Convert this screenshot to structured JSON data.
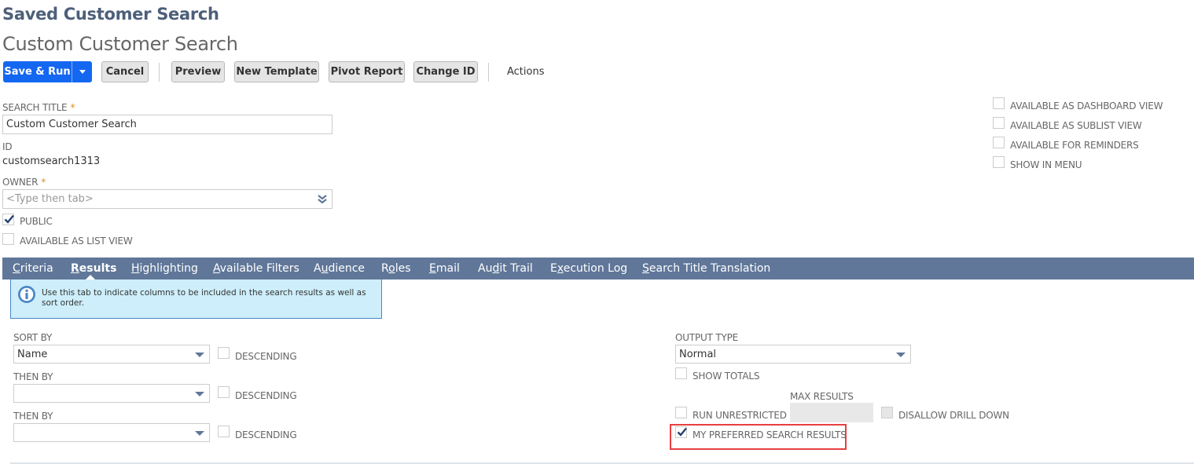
{
  "header": {
    "record_type": "Saved Customer Search",
    "record_name": "Custom Customer Search"
  },
  "toolbar": {
    "save_run_label": "Save & Run",
    "cancel_label": "Cancel",
    "preview_label": "Preview",
    "new_template_label": "New Template",
    "pivot_report_label": "Pivot Report",
    "change_id_label": "Change ID",
    "actions_label": "Actions"
  },
  "form": {
    "search_title": {
      "label": "Search Title",
      "required_mark": "*",
      "value": "Custom Customer Search"
    },
    "id": {
      "label": "ID",
      "value": "customsearch1313"
    },
    "owner": {
      "label": "Owner",
      "required_mark": "*",
      "placeholder": "<Type then tab>"
    },
    "public": {
      "label": "Public",
      "checked": true
    },
    "available_as_list_view": {
      "label": "Available as List View",
      "checked": false
    },
    "right_options": [
      {
        "label": "Available as Dashboard View",
        "checked": false
      },
      {
        "label": "Available as Sublist View",
        "checked": false
      },
      {
        "label": "Available for Reminders",
        "checked": false
      },
      {
        "label": "Show in Menu",
        "checked": false
      }
    ]
  },
  "tabs": [
    {
      "pre": "",
      "u": "C",
      "post": "riteria",
      "active": false
    },
    {
      "pre": "",
      "u": "R",
      "post": "esults",
      "active": true
    },
    {
      "pre": "",
      "u": "H",
      "post": "ighlighting",
      "active": false
    },
    {
      "pre": "",
      "u": "A",
      "post": "vailable Filters",
      "active": false
    },
    {
      "pre": "A",
      "u": "u",
      "post": "dience",
      "active": false
    },
    {
      "pre": "R",
      "u": "o",
      "post": "les",
      "active": false
    },
    {
      "pre": "",
      "u": "E",
      "post": "mail",
      "active": false
    },
    {
      "pre": "Au",
      "u": "d",
      "post": "it Trail",
      "active": false
    },
    {
      "pre": "E",
      "u": "x",
      "post": "ecution Log",
      "active": false
    },
    {
      "pre": "",
      "u": "S",
      "post": "earch Title Translation",
      "active": false
    }
  ],
  "info_message": "Use this tab to indicate columns to be included in the search results as well as sort order.",
  "results": {
    "sort_by": {
      "label": "Sort By",
      "value": "Name",
      "descending_label": "Descending",
      "descending": false
    },
    "then_by_1": {
      "label": "Then By",
      "value": "",
      "descending_label": "Descending",
      "descending": false
    },
    "then_by_2": {
      "label": "Then By",
      "value": "",
      "descending_label": "Descending",
      "descending": false
    },
    "output_type": {
      "label": "Output Type",
      "value": "Normal"
    },
    "show_totals": {
      "label": "Show Totals",
      "checked": false
    },
    "max_results": {
      "label": "Max Results",
      "value": ""
    },
    "run_unrestricted": {
      "label": "Run Unrestricted",
      "checked": false
    },
    "disallow_drill_down": {
      "label": "Disallow Drill Down",
      "checked": false,
      "disabled": true
    },
    "my_preferred_search_results": {
      "label": "My Preferred Search Results",
      "checked": true,
      "highlighted": true
    }
  },
  "colors": {
    "primary_button": "#1467f0",
    "tab_bar": "#607799",
    "info_bg": "#cdeefa",
    "highlight_border": "#e5403f",
    "title": "#4d5f79"
  }
}
